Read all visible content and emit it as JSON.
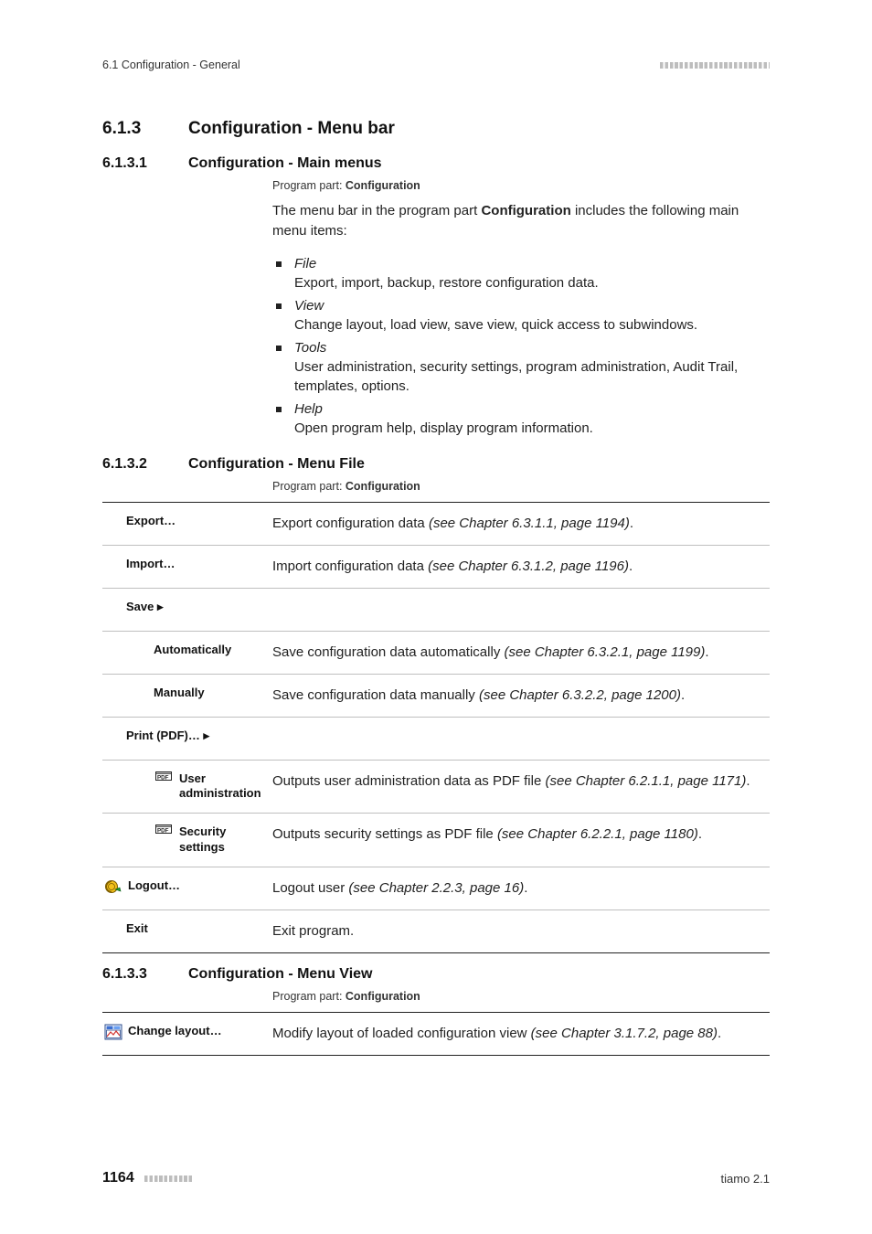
{
  "header": {
    "left": "6.1 Configuration - General"
  },
  "sections": {
    "s613": {
      "num": "6.1.3",
      "title": "Configuration - Menu bar"
    },
    "s6131": {
      "num": "6.1.3.1",
      "title": "Configuration - Main menus",
      "program_part_label": "Program part: ",
      "program_part_value": "Configuration",
      "intro_pre": "The menu bar in the program part ",
      "intro_bold": "Configuration",
      "intro_post": " includes the following main menu items:",
      "menus": [
        {
          "name": "File",
          "desc": "Export, import, backup, restore configuration data."
        },
        {
          "name": "View",
          "desc": "Change layout, load view, save view, quick access to subwindows."
        },
        {
          "name": "Tools",
          "desc": "User administration, security settings, program administration, Audit Trail, templates, options."
        },
        {
          "name": "Help",
          "desc": "Open program help, display program information."
        }
      ]
    },
    "s6132": {
      "num": "6.1.3.2",
      "title": "Configuration - Menu File",
      "program_part_label": "Program part: ",
      "program_part_value": "Configuration",
      "rows": [
        {
          "label": "Export…",
          "desc": "Export configuration data ",
          "ref": "(see Chapter 6.3.1.1, page 1194)",
          "tail": "."
        },
        {
          "label": "Import…",
          "desc": "Import configuration data ",
          "ref": "(see Chapter 6.3.1.2, page 1196)",
          "tail": "."
        },
        {
          "label": "Save ▸",
          "desc": ""
        },
        {
          "label": "Automatically",
          "sub": true,
          "desc": "Save configuration data automatically ",
          "ref": "(see Chapter 6.3.2.1, page 1199)",
          "tail": "."
        },
        {
          "label": "Manually",
          "sub": true,
          "desc": "Save configuration data manually ",
          "ref": "(see Chapter 6.3.2.2, page 1200)",
          "tail": "."
        },
        {
          "label": "Print (PDF)… ▸",
          "desc": ""
        },
        {
          "label": "User administration",
          "sub": true,
          "icon": "pdf",
          "desc": "Outputs user administration data as PDF file ",
          "ref": "(see Chapter 6.2.1.1, page 1171)",
          "tail": "."
        },
        {
          "label": "Security settings",
          "sub": true,
          "icon": "pdf",
          "desc": "Outputs security settings as PDF file ",
          "ref": "(see Chapter 6.2.2.1, page 1180)",
          "tail": "."
        },
        {
          "label": "Logout…",
          "outer": true,
          "icon": "logout",
          "desc": "Logout user ",
          "ref": "(see Chapter 2.2.3, page 16)",
          "tail": "."
        },
        {
          "label": "Exit",
          "desc": "Exit program."
        }
      ]
    },
    "s6133": {
      "num": "6.1.3.3",
      "title": "Configuration - Menu View",
      "program_part_label": "Program part: ",
      "program_part_value": "Configuration",
      "rows": [
        {
          "label": "Change layout…",
          "outer": true,
          "icon": "layout",
          "desc": "Modify layout of loaded configuration view ",
          "ref": "(see Chapter 3.1.7.2, page 88)",
          "tail": "."
        }
      ]
    }
  },
  "footer": {
    "page": "1164",
    "right": "tiamo 2.1"
  }
}
